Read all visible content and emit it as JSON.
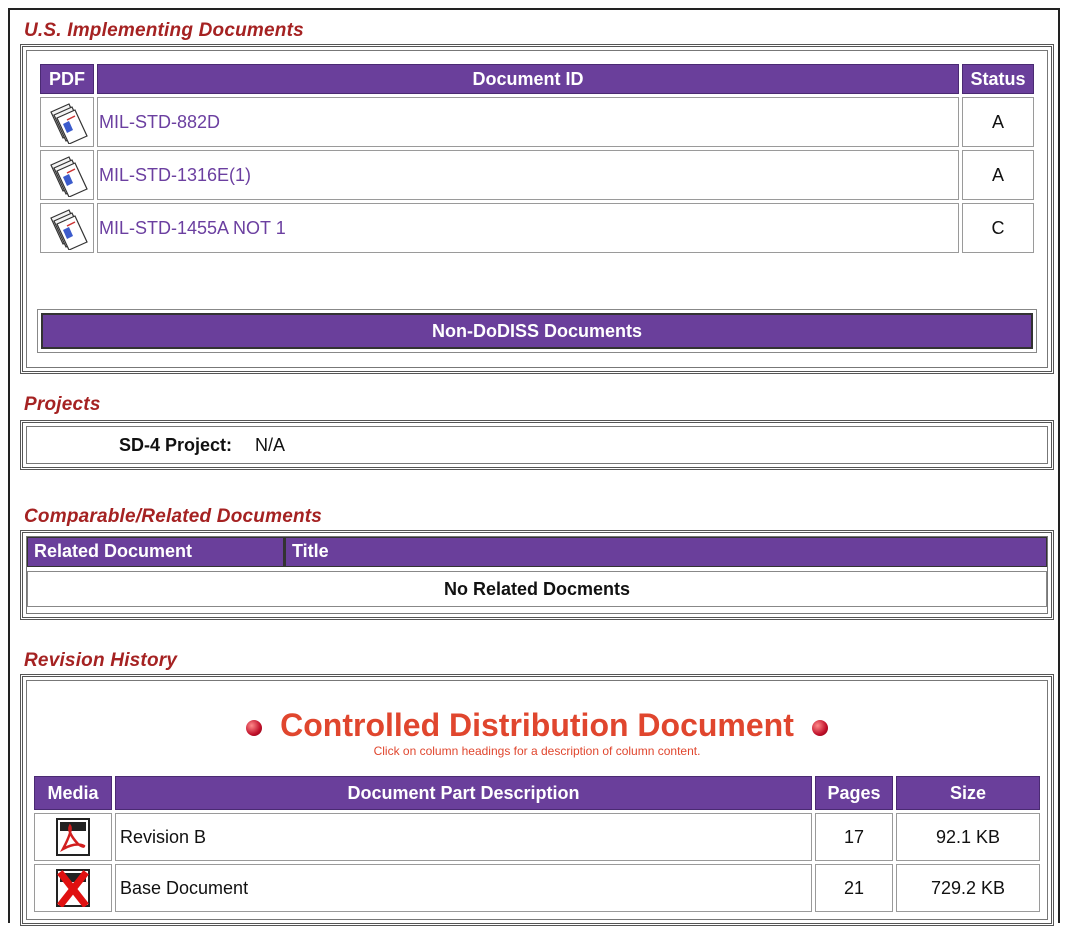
{
  "sections": {
    "implementing_title": "U.S. Implementing Documents",
    "projects_title": "Projects",
    "related_title": "Comparable/Related Documents",
    "revision_title": "Revision History"
  },
  "implementing": {
    "headers": {
      "pdf": "PDF",
      "doc_id": "Document ID",
      "status": "Status"
    },
    "rows": [
      {
        "doc_id": "MIL-STD-882D",
        "status": "A"
      },
      {
        "doc_id": "MIL-STD-1316E(1)",
        "status": "A"
      },
      {
        "doc_id": "MIL-STD-1455A NOT 1",
        "status": "C"
      }
    ],
    "non_dodiss_label": "Non-DoDISS Documents"
  },
  "projects": {
    "label": "SD-4 Project:",
    "value": "N/A"
  },
  "related": {
    "headers": {
      "related_doc": "Related Document",
      "title": "Title"
    },
    "empty_message": "No Related Docments"
  },
  "revision": {
    "banner": "Controlled Distribution Document",
    "note": "Click on column headings for a description of column content.",
    "headers": {
      "media": "Media",
      "description": "Document Part Description",
      "pages": "Pages",
      "size": "Size"
    },
    "rows": [
      {
        "description": "Revision B",
        "pages": "17",
        "size": "92.1 KB",
        "icon": "pdf-icon"
      },
      {
        "description": "Base Document",
        "pages": "21",
        "size": "729.2 KB",
        "icon": "pdf-unavailable-icon"
      }
    ]
  },
  "colors": {
    "header_purple": "#6a3f9b",
    "section_red": "#a52222",
    "banner_red": "#e0462e",
    "link_purple": "#6b3fa0"
  }
}
